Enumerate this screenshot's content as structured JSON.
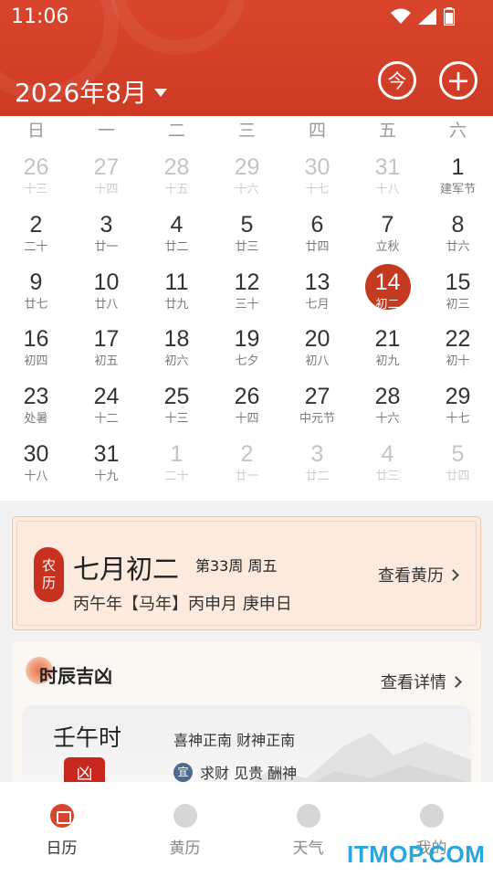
{
  "status_bar": {
    "time": "11:06"
  },
  "header": {
    "month_title": "2026年8月",
    "today_button": "今",
    "add_button": "+"
  },
  "weekdays": [
    "日",
    "一",
    "二",
    "三",
    "四",
    "五",
    "六"
  ],
  "days": [
    {
      "n": "26",
      "l": "十三",
      "other": true
    },
    {
      "n": "27",
      "l": "十四",
      "other": true
    },
    {
      "n": "28",
      "l": "十五",
      "other": true
    },
    {
      "n": "29",
      "l": "十六",
      "other": true
    },
    {
      "n": "30",
      "l": "十七",
      "other": true
    },
    {
      "n": "31",
      "l": "十八",
      "other": true
    },
    {
      "n": "1",
      "l": "建军节",
      "festival": true
    },
    {
      "n": "2",
      "l": "二十"
    },
    {
      "n": "3",
      "l": "廿一"
    },
    {
      "n": "4",
      "l": "廿二"
    },
    {
      "n": "5",
      "l": "廿三"
    },
    {
      "n": "6",
      "l": "廿四"
    },
    {
      "n": "7",
      "l": "立秋",
      "festival": true
    },
    {
      "n": "8",
      "l": "廿六"
    },
    {
      "n": "9",
      "l": "廿七"
    },
    {
      "n": "10",
      "l": "廿八"
    },
    {
      "n": "11",
      "l": "廿九"
    },
    {
      "n": "12",
      "l": "三十"
    },
    {
      "n": "13",
      "l": "七月"
    },
    {
      "n": "14",
      "l": "初二",
      "selected": true
    },
    {
      "n": "15",
      "l": "初三"
    },
    {
      "n": "16",
      "l": "初四"
    },
    {
      "n": "17",
      "l": "初五"
    },
    {
      "n": "18",
      "l": "初六"
    },
    {
      "n": "19",
      "l": "七夕",
      "festival": true
    },
    {
      "n": "20",
      "l": "初八"
    },
    {
      "n": "21",
      "l": "初九"
    },
    {
      "n": "22",
      "l": "初十"
    },
    {
      "n": "23",
      "l": "处暑",
      "festival": true
    },
    {
      "n": "24",
      "l": "十二"
    },
    {
      "n": "25",
      "l": "十三"
    },
    {
      "n": "26",
      "l": "十四"
    },
    {
      "n": "27",
      "l": "中元节",
      "festival": true
    },
    {
      "n": "28",
      "l": "十六"
    },
    {
      "n": "29",
      "l": "十七"
    },
    {
      "n": "30",
      "l": "十八"
    },
    {
      "n": "31",
      "l": "十九"
    },
    {
      "n": "1",
      "l": "二十",
      "other": true
    },
    {
      "n": "2",
      "l": "廿一",
      "other": true
    },
    {
      "n": "3",
      "l": "廿二",
      "other": true
    },
    {
      "n": "4",
      "l": "廿三",
      "other": true
    },
    {
      "n": "5",
      "l": "廿四",
      "other": true
    }
  ],
  "lunar_card": {
    "seal_top": "农",
    "seal_bottom": "历",
    "lunar_date": "七月初二",
    "week_info": "第33周 周五",
    "ganzhi": "丙午年【马年】丙申月 庚申日",
    "link": "查看黄历"
  },
  "shichen": {
    "title": "时辰吉凶",
    "link": "查看详情",
    "name": "壬午时",
    "badge": "凶",
    "gods": "喜神正南 财神正南",
    "yi_label": "宜",
    "yi_text": "求财 见贵 酬神"
  },
  "tabs": [
    {
      "label": "日历",
      "active": true
    },
    {
      "label": "黄历"
    },
    {
      "label": "天气"
    },
    {
      "label": "我的"
    }
  ],
  "watermark": "ITMOP.COM",
  "colors": {
    "brand_red": "#d9452c",
    "selected_red": "#c33a21",
    "card_bg": "#fbeadd",
    "watermark_blue": "#2aa6df"
  }
}
